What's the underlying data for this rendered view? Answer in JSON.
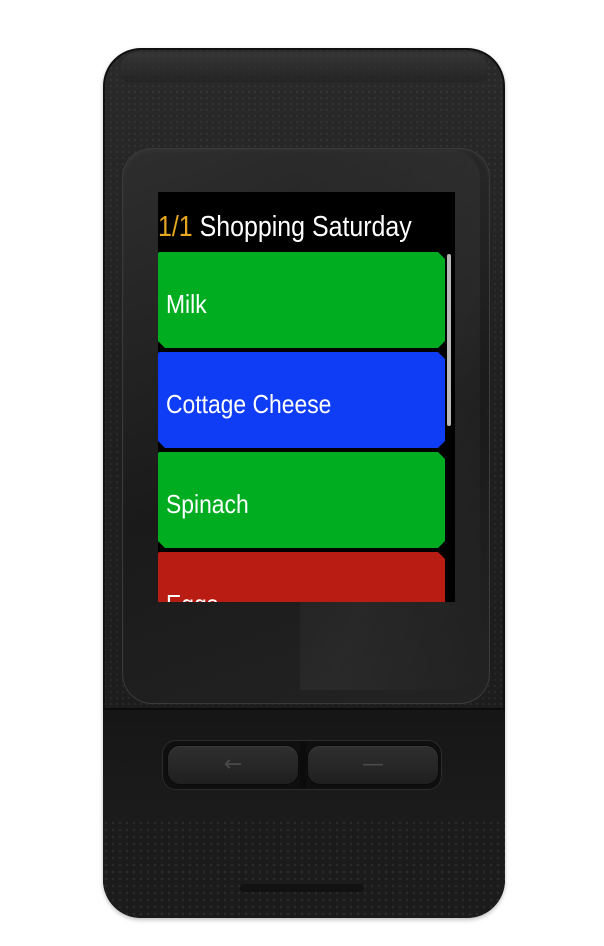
{
  "device": {
    "name_icon": "garmin-watch-body",
    "buttons": [
      {
        "icon": "back-arrow-icon",
        "glyph": "←"
      },
      {
        "icon": "menu-dash-icon",
        "glyph": "—"
      }
    ]
  },
  "header": {
    "counter": "1/1",
    "title": "Shopping Saturday"
  },
  "list": {
    "items": [
      {
        "label": "Milk",
        "color": "#00ad21"
      },
      {
        "label": "Cottage Cheese",
        "color": "#0f3df5"
      },
      {
        "label": "Spinach",
        "color": "#00ad21"
      },
      {
        "label": "Eggs",
        "color": "#b81c12"
      }
    ]
  },
  "colors": {
    "counter": "#e8a721",
    "screen_bg": "#000000",
    "scrollbar": "#b8b8b8"
  },
  "scroll": {
    "thumb_fraction": 0.49
  }
}
